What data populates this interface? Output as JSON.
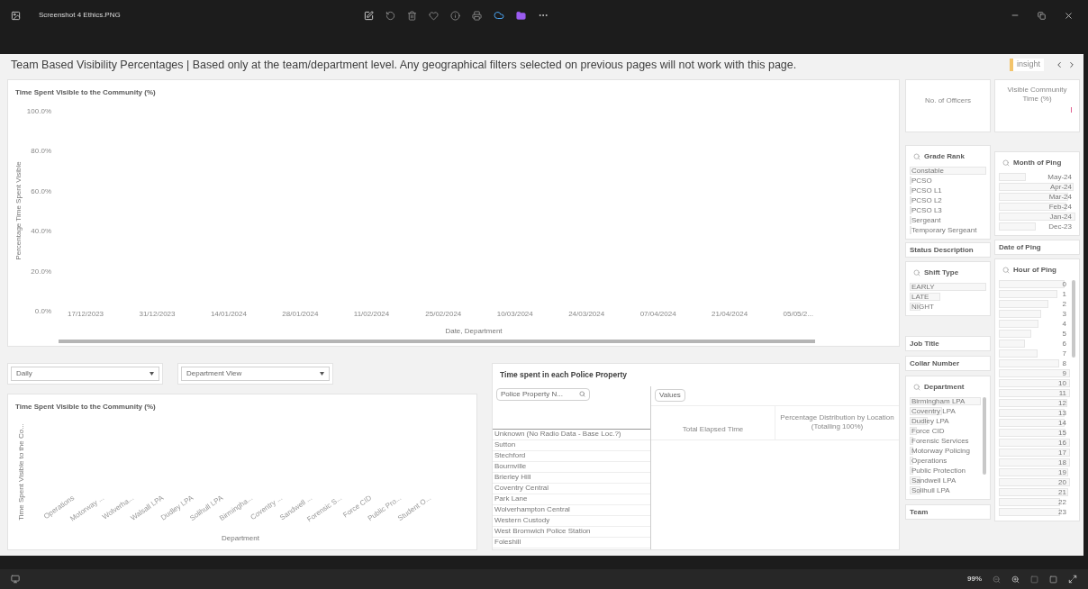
{
  "viewer": {
    "title": "Screenshot 4 Ethics.PNG",
    "zoom": "99%"
  },
  "sheet": {
    "title": "Team Based Visibility Percentages | Based only at the team/department level. Any geographical filters selected on previous pages will not work with this page.",
    "logo": "insight"
  },
  "trend_chart": {
    "title": "Time Spent Visible to the Community (%)",
    "chart_data": {
      "type": "bar",
      "xlabel": "Date, Department",
      "ylabel": "Percentage Time Spent Visible",
      "categories": [
        "17/12/2023",
        "31/12/2023",
        "14/01/2024",
        "28/01/2024",
        "11/02/2024",
        "25/02/2024",
        "10/03/2024",
        "24/03/2024",
        "07/04/2024",
        "21/04/2024",
        "05/05/2..."
      ],
      "values": [
        null,
        null,
        null,
        null,
        null,
        null,
        null,
        null,
        null,
        null,
        null
      ],
      "ylim": [
        0,
        1
      ],
      "yticks": [
        {
          "value": 0,
          "label": "0.0%"
        },
        {
          "value": 0.2,
          "label": "20.0%"
        },
        {
          "value": 0.4,
          "label": "40.0%"
        },
        {
          "value": 0.6,
          "label": "60.0%"
        },
        {
          "value": 0.8,
          "label": "80.0%"
        },
        {
          "value": 1,
          "label": "100.0%"
        }
      ]
    }
  },
  "dropdowns": [
    {
      "value": "Daily"
    },
    {
      "value": "Department View"
    }
  ],
  "department_chart": {
    "title": "Time Spent Visible to the Community (%)",
    "ylabel": "Time Spent Visible to the Co...",
    "xlabel": "Department",
    "categories": [
      "Operations",
      "Motorway ...",
      "Wolverha...",
      "Walsall LPA",
      "Dudley LPA",
      "Solihull LPA",
      "Birmingha...",
      "Coventry ...",
      "Sandwell ...",
      "Forensic S...",
      "Force CID",
      "Public Pro...",
      "Student O..."
    ]
  },
  "property_table": {
    "title": "Time spent in each Police Property",
    "search": "Police Property N...",
    "values_button": "Values",
    "columns": [
      "Total Elapsed Time",
      "Percentage Distribution by Location (Totalling 100%)"
    ],
    "rows": [
      "Unknown (No Radio Data - Base Loc.?)",
      "Sutton",
      "Stechford",
      "Bournville",
      "Brierley Hill",
      "Coventry Central",
      "Park Lane",
      "Wolverhampton Central",
      "Western Custody",
      "West Bromwich Police Station",
      "Foleshill"
    ]
  },
  "kpis": [
    {
      "label": "No. of Officers"
    },
    {
      "label": "Visible Community Time (%)"
    }
  ],
  "filters_left": [
    {
      "kind": "list",
      "title": "Grade Rank",
      "items": [
        {
          "label": "Constable",
          "level": 1
        },
        {
          "label": "PCSO",
          "level": 0
        },
        {
          "label": "PCSO L1",
          "level": 0
        },
        {
          "label": "PCSO L2",
          "level": 0
        },
        {
          "label": "PCSO L3",
          "level": 0
        },
        {
          "label": "Sergeant",
          "level": 0
        },
        {
          "label": "Temporary Sergeant",
          "level": 0
        }
      ]
    },
    {
      "kind": "collapsed",
      "title": "Status Description"
    },
    {
      "kind": "list",
      "title": "Shift Type",
      "items": [
        {
          "label": "EARLY",
          "level": 1
        },
        {
          "label": "LATE",
          "level": 0.4
        },
        {
          "label": "NIGHT",
          "level": 0.14
        }
      ]
    },
    {
      "kind": "collapsed",
      "title": "Job Title"
    },
    {
      "kind": "collapsed",
      "title": "Collar Number"
    },
    {
      "kind": "list",
      "title": "Department",
      "items": [
        {
          "label": "Birmingham LPA",
          "level": 1
        },
        {
          "label": "Coventry LPA",
          "level": 0.45
        },
        {
          "label": "Dudley LPA",
          "level": 0.25
        },
        {
          "label": "Force CID",
          "level": 0.1
        },
        {
          "label": "Forensic Services",
          "level": 0.05
        },
        {
          "label": "Motorway Policing",
          "level": 0.05
        },
        {
          "label": "Operations",
          "level": 0.05
        },
        {
          "label": "Public Protection",
          "level": 0.05
        },
        {
          "label": "Sandwell LPA",
          "level": 0.15
        },
        {
          "label": "Solihull LPA",
          "level": 0.15
        }
      ]
    },
    {
      "kind": "collapsed",
      "title": "Team"
    }
  ],
  "filters_right": [
    {
      "kind": "bars",
      "title": "Month of Ping",
      "items": [
        {
          "label": "May-24",
          "level": 0.35
        },
        {
          "label": "Apr-24",
          "level": 0.98
        },
        {
          "label": "Mar-24",
          "level": 0.9
        },
        {
          "label": "Feb-24",
          "level": 0.88
        },
        {
          "label": "Jan-24",
          "level": 1
        },
        {
          "label": "Dec-23",
          "level": 0.48
        }
      ]
    },
    {
      "kind": "collapsed",
      "title": "Date of Ping"
    },
    {
      "kind": "bars",
      "title": "Hour of Ping",
      "items": [
        {
          "label": "0",
          "level": 0.92
        },
        {
          "label": "1",
          "level": 0.82
        },
        {
          "label": "2",
          "level": 0.7
        },
        {
          "label": "3",
          "level": 0.6
        },
        {
          "label": "4",
          "level": 0.56
        },
        {
          "label": "5",
          "level": 0.46
        },
        {
          "label": "6",
          "level": 0.37
        },
        {
          "label": "7",
          "level": 0.55
        },
        {
          "label": "8",
          "level": 0.85
        },
        {
          "label": "9",
          "level": 1
        },
        {
          "label": "10",
          "level": 1
        },
        {
          "label": "11",
          "level": 1
        },
        {
          "label": "12",
          "level": 0.96
        },
        {
          "label": "13",
          "level": 0.92
        },
        {
          "label": "14",
          "level": 0.92
        },
        {
          "label": "15",
          "level": 0.94
        },
        {
          "label": "16",
          "level": 1
        },
        {
          "label": "17",
          "level": 1
        },
        {
          "label": "18",
          "level": 1
        },
        {
          "label": "19",
          "level": 0.98
        },
        {
          "label": "20",
          "level": 1
        },
        {
          "label": "21",
          "level": 0.97
        },
        {
          "label": "22",
          "level": 0.86
        },
        {
          "label": "23",
          "level": 0.86
        }
      ]
    }
  ]
}
